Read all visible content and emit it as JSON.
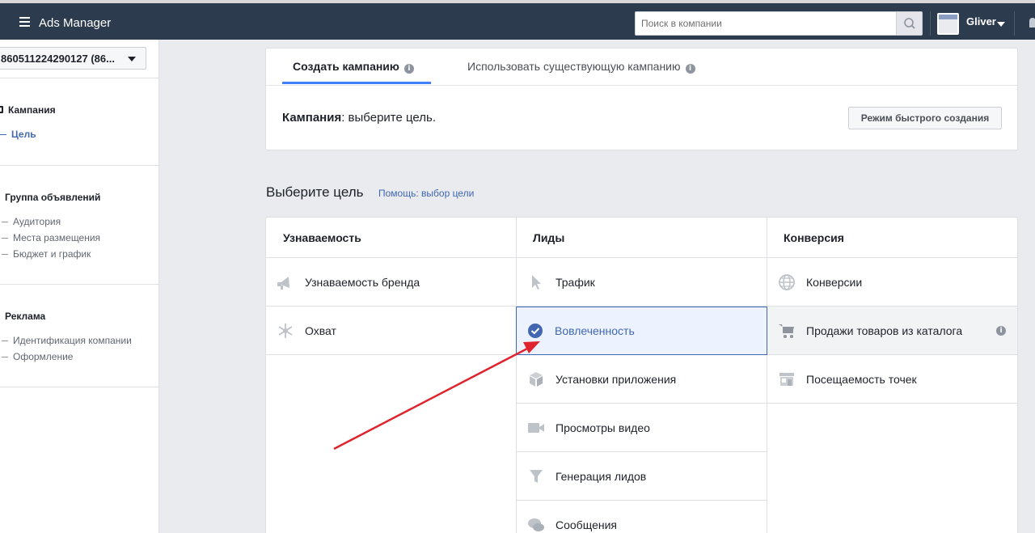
{
  "topbar": {
    "app_title": "Ads Manager",
    "search_placeholder": "Поиск в компании",
    "user_name": "Gliver"
  },
  "sidebar": {
    "account": "860511224290127 (86...",
    "campaign_header": "Кампания",
    "campaign_items": [
      "Цель"
    ],
    "adset_header": "Группа объявлений",
    "adset_items": [
      "Аудитория",
      "Места размещения",
      "Бюджет и график"
    ],
    "ad_header": "Реклама",
    "ad_items": [
      "Идентификация компании",
      "Оформление"
    ]
  },
  "card": {
    "tab_create": "Создать кампанию",
    "tab_existing": "Использовать существующую кампанию",
    "campaign_label": "Кампания",
    "campaign_text": ": выберите цель.",
    "quick_button": "Режим быстрого создания"
  },
  "objectives": {
    "title": "Выберите цель",
    "help_link": "Помощь: выбор цели",
    "columns": [
      {
        "header": "Узнаваемость",
        "items": [
          "Узнаваемость бренда",
          "Охват"
        ]
      },
      {
        "header": "Лиды",
        "items": [
          "Трафик",
          "Вовлеченность",
          "Установки приложения",
          "Просмотры видео",
          "Генерация лидов",
          "Сообщения"
        ]
      },
      {
        "header": "Конверсия",
        "items": [
          "Конверсии",
          "Продажи товаров из каталога",
          "Посещаемость точек"
        ]
      }
    ],
    "selected": "Вовлеченность",
    "accent_color": "#4267b2",
    "annotation_arrow_color": "#e0242e"
  }
}
